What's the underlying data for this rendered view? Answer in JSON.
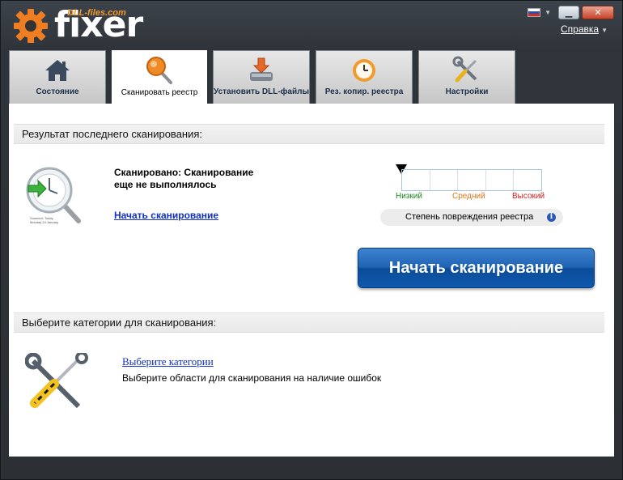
{
  "header": {
    "brand": "DLL-files.com",
    "app_name": "fixer",
    "help_label": "Справка"
  },
  "window_controls": {
    "language_flag": "flag-ru-icon",
    "minimize": "minimize-icon",
    "close": "close-icon"
  },
  "tabs": [
    {
      "label": "Состояние",
      "icon": "home-icon"
    },
    {
      "label": "Сканировать реестр",
      "icon": "magnifier-icon",
      "active": true
    },
    {
      "label": "Установить DLL-файлы",
      "icon": "download-drive-icon"
    },
    {
      "label": "Рез. копир. реестра",
      "icon": "clock-backup-icon"
    },
    {
      "label": "Настройки",
      "icon": "tools-icon"
    }
  ],
  "scan_section": {
    "header": "Результат последнего сканирования:",
    "status_line1": "Сканировано: Сканирование",
    "status_line2": "еще не выполнялось",
    "start_link": "Начать сканирование",
    "icon_caption1": "Scanned: Today",
    "icon_caption2": "Monday 24 January",
    "meter_levels": {
      "low": "Низкий",
      "mid": "Средний",
      "high": "Высокий"
    },
    "damage_label": "Степень повреждения реестра",
    "damage_level": 0,
    "start_button": "Начать сканирование"
  },
  "categories_section": {
    "header": "Выберите категории для сканирования:",
    "link": "Выберите категории",
    "description": "Выберите области для сканирования на наличие ошибок"
  },
  "colors": {
    "accent_orange": "#f39a2b",
    "button_blue": "#1f63b3",
    "link_blue": "#1030c0",
    "low": "#1d8a1d",
    "mid": "#e0761a",
    "high": "#d51d1d"
  }
}
